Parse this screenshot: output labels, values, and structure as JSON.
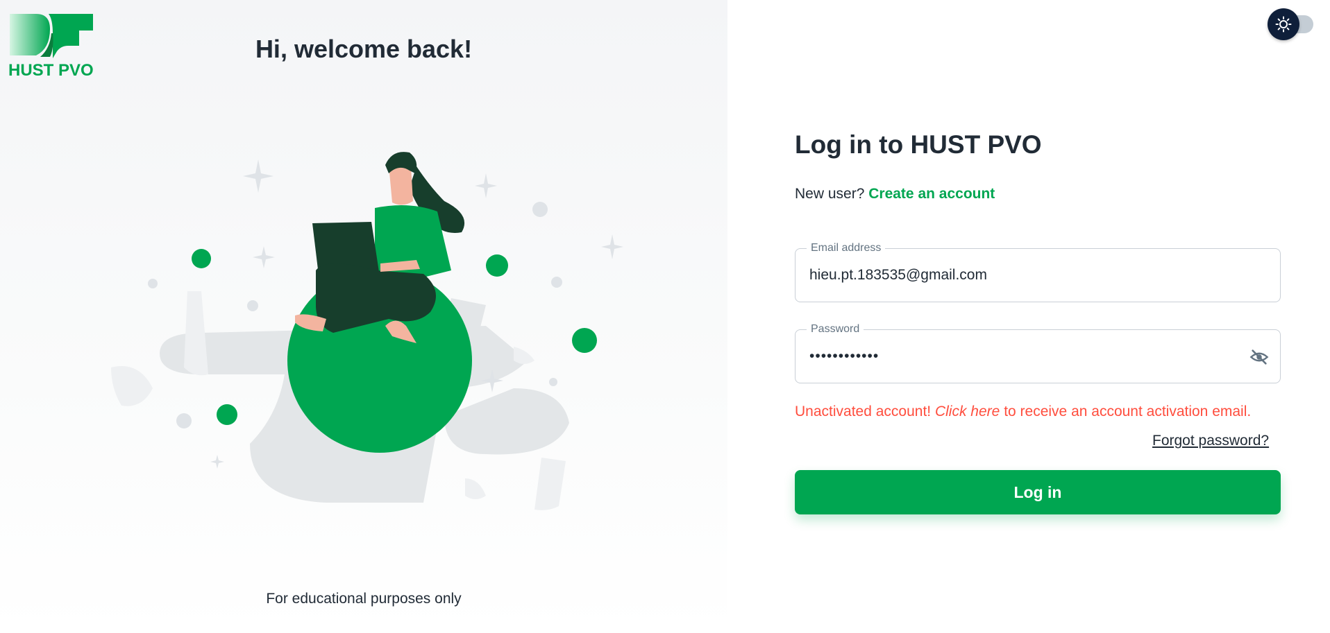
{
  "brand": {
    "logo_text": "HUST PVO",
    "primary_color": "#00a651",
    "dark_green": "#173e2c"
  },
  "hero": {
    "welcome_title": "Hi, welcome back!",
    "illustration": "woman-with-laptop-on-ball-illustration",
    "footer_note": "For educational purposes only"
  },
  "theme_toggle": {
    "icon": "sun-icon",
    "mode": "light"
  },
  "login_form": {
    "title": "Log in to HUST PVO",
    "new_user_prompt": "New user?",
    "create_account_link": "Create an account",
    "email": {
      "label": "Email address",
      "value": "hieu.pt.183535@gmail.com"
    },
    "password": {
      "label": "Password",
      "value": "••••••••••••",
      "visibility_icon": "eye-off-icon"
    },
    "error": {
      "prefix": "Unactivated account!",
      "link": "Click here",
      "suffix": "to receive an account activation email.",
      "color": "#ff4d3d"
    },
    "forgot_password": "Forgot password?",
    "submit_label": "Log in"
  }
}
